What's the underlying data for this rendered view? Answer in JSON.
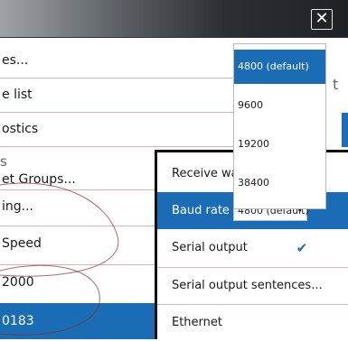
{
  "window": {
    "close_icon": "x-icon",
    "close_symbol": "✕"
  },
  "left_list": {
    "side_char_1": "t",
    "side_char_2": "s",
    "items": [
      {
        "label": "es..."
      },
      {
        "label": "e list"
      },
      {
        "label": "ostics"
      },
      {
        "label": "et Groups..."
      },
      {
        "label": "ing..."
      },
      {
        "label": "Speed"
      },
      {
        "label": "2000"
      },
      {
        "label": "0183"
      }
    ]
  },
  "baud_dropdown": {
    "options": [
      {
        "label": "4800 (default)"
      },
      {
        "label": "9600"
      },
      {
        "label": "19200"
      },
      {
        "label": "38400"
      }
    ],
    "selected_index": 0
  },
  "panel": {
    "rows": [
      {
        "label": "Receive wa"
      },
      {
        "label": "Baud rate",
        "value": "4800 (default)",
        "caret": "▾"
      },
      {
        "label": "Serial output",
        "checked": true,
        "check_symbol": "✔"
      },
      {
        "label": "Serial output sentences..."
      },
      {
        "label": "Ethernet"
      }
    ]
  },
  "colors": {
    "accent": "#1a6db4",
    "titlebar_dark": "#1f2225",
    "separator": "#c97b7b"
  }
}
